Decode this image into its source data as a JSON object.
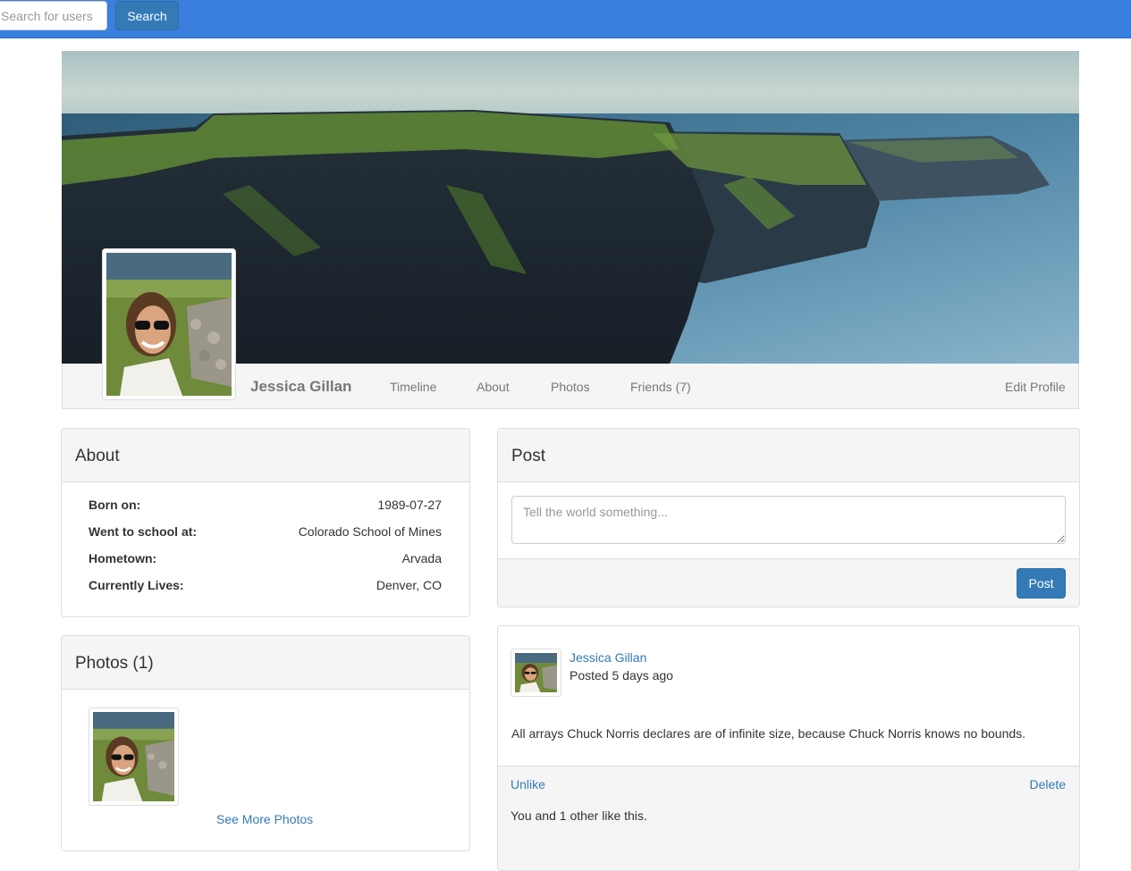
{
  "nav": {
    "search_placeholder": "Search for users",
    "search_button": "Search"
  },
  "profile": {
    "name": "Jessica Gillan",
    "tabs": [
      "Timeline",
      "About",
      "Photos",
      "Friends (7)"
    ],
    "edit_label": "Edit Profile"
  },
  "about": {
    "title": "About",
    "rows": [
      {
        "label": "Born on:",
        "value": "1989-07-27"
      },
      {
        "label": "Went to school at:",
        "value": "Colorado School of Mines"
      },
      {
        "label": "Hometown:",
        "value": "Arvada"
      },
      {
        "label": "Currently Lives:",
        "value": "Denver, CO"
      }
    ]
  },
  "photos": {
    "title": "Photos (1)",
    "see_more": "See More Photos"
  },
  "composer": {
    "title": "Post",
    "placeholder": "Tell the world something...",
    "button": "Post"
  },
  "feed_post": {
    "author": "Jessica Gillan",
    "time": "Posted 5 days ago",
    "body": "All arrays Chuck Norris declares are of infinite size, because Chuck Norris knows no bounds.",
    "unlike": "Unlike",
    "delete": "Delete",
    "likes": "You and 1 other like this."
  },
  "colors": {
    "navbar": "#3b7fde",
    "primary": "#337ab7",
    "panel_heading": "#f5f5f5",
    "link": "#337ab7"
  },
  "icons": {
    "cover": "cover-photo",
    "avatar": "profile-picture"
  }
}
